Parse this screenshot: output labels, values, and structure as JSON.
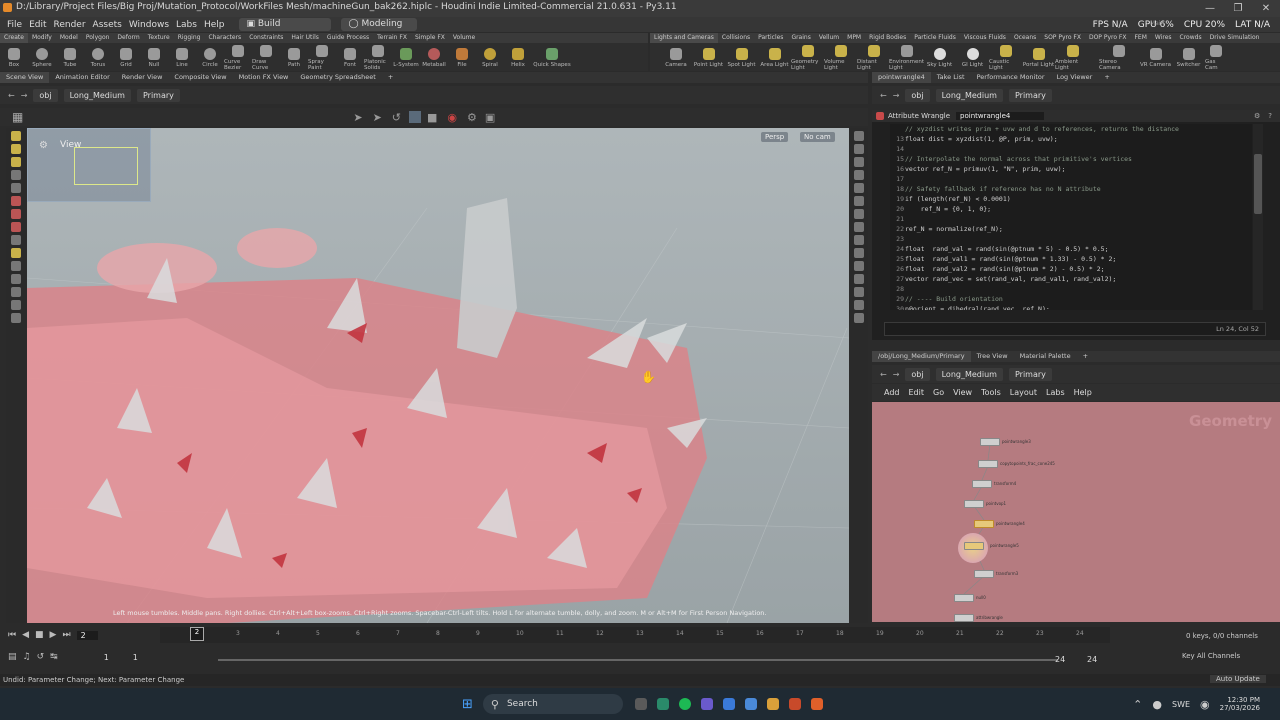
{
  "window": {
    "title": "D:/Library/Project Files/Big Proj/Mutation_Protocol/WorkFiles Mesh/machineGun_bak262.hiplc - Houdini Indie Limited-Commercial 21.0.631 - Py3.11"
  },
  "menubar": {
    "items": [
      "File",
      "Edit",
      "Render",
      "Assets",
      "Windows",
      "Labs",
      "Help"
    ],
    "desktops": [
      "Build",
      "Modeling"
    ],
    "stats": {
      "fps": "FPS N/A",
      "gpu": "GPU 6%",
      "cpu": "CPU 20%",
      "lat": "LAT N/A"
    },
    "main_label": "Main"
  },
  "shelf_left": {
    "tabs": [
      "Create",
      "Modify",
      "Model",
      "Polygon",
      "Deform",
      "Texture",
      "Rigging",
      "Characters",
      "Constraints",
      "Hair Utils",
      "Guide Process",
      "Terrain FX",
      "Simple FX",
      "Volume"
    ],
    "tools": [
      "Box",
      "Sphere",
      "Tube",
      "Torus",
      "Grid",
      "Null",
      "Line",
      "Circle",
      "Curve Bezier",
      "Draw Curve",
      "Path",
      "Spray Paint",
      "Font",
      "Platonic Solids",
      "L-System",
      "Metaball",
      "File",
      "Spiral",
      "Helix",
      "Quick Shapes"
    ]
  },
  "shelf_right": {
    "tabs": [
      "Lights and Cameras",
      "Collisions",
      "Particles",
      "Grains",
      "Vellum",
      "MPM",
      "Rigid Bodies",
      "Particle Fluids",
      "Viscous Fluids",
      "Oceans",
      "SOP Pyro FX",
      "DOP Pyro FX",
      "FEM",
      "Wires",
      "Crowds",
      "Drive Simulation"
    ],
    "tools": [
      "Camera",
      "Point Light",
      "Spot Light",
      "Area Light",
      "Geometry Light",
      "Volume Light",
      "Distant Light",
      "Environment Light",
      "Sky Light",
      "GI Light",
      "Caustic Light",
      "Portal Light",
      "Ambient Light",
      "Stereo Camera",
      "VR Camera",
      "Switcher",
      "Gas Cam"
    ]
  },
  "left_pane": {
    "tabs": [
      "Scene View",
      "Animation Editor",
      "Render View",
      "Composite View",
      "Motion FX View",
      "Geometry Spreadsheet"
    ],
    "path": [
      "obj",
      "Long_Medium",
      "Primary"
    ],
    "view_label": "View",
    "persp": "Persp",
    "cam": "No cam",
    "hint": "Left mouse tumbles. Middle pans. Right dollies. Ctrl+Alt+Left box-zooms. Ctrl+Right zooms. Spacebar-Ctrl-Left tilts. Hold L for alternate tumble, dolly, and zoom. M or Alt+M for First Person Navigation."
  },
  "right_top_pane": {
    "tabs": [
      "pointwrangle4",
      "Take List",
      "Performance Monitor",
      "Log Viewer"
    ],
    "path": [
      "obj",
      "Long_Medium",
      "Primary"
    ],
    "node_type": "Attribute Wrangle",
    "node_name": "pointwrangle4",
    "cursor_pos": "Ln 24, Col 52",
    "code_lines": [
      {
        "n": "",
        "t": "// xyzdist writes prim + uvw and d to references, returns the distance",
        "c": true
      },
      {
        "n": "13",
        "t": "float dist = xyzdist(1, @P, prim, uvw);",
        "c": false
      },
      {
        "n": "14",
        "t": "",
        "c": false
      },
      {
        "n": "15",
        "t": "// Interpolate the normal across that primitive's vertices",
        "c": true
      },
      {
        "n": "16",
        "t": "vector ref_N = primuv(1, \"N\", prim, uvw);",
        "c": false
      },
      {
        "n": "17",
        "t": "",
        "c": false
      },
      {
        "n": "18",
        "t": "// Safety fallback if reference has no N attribute",
        "c": true
      },
      {
        "n": "19",
        "t": "if (length(ref_N) < 0.0001)",
        "c": false
      },
      {
        "n": "20",
        "t": "    ref_N = {0, 1, 0};",
        "c": false
      },
      {
        "n": "21",
        "t": "",
        "c": false
      },
      {
        "n": "22",
        "t": "ref_N = normalize(ref_N);",
        "c": false
      },
      {
        "n": "23",
        "t": "",
        "c": false
      },
      {
        "n": "24",
        "t": "float  rand_val = rand(sin(@ptnum * 5) - 0.5) * 0.5;",
        "c": false
      },
      {
        "n": "25",
        "t": "float  rand_val1 = rand(sin(@ptnum * 1.33) - 0.5) * 2;",
        "c": false
      },
      {
        "n": "26",
        "t": "float  rand_val2 = rand(sin(@ptnum * 2) - 0.5) * 2;",
        "c": false
      },
      {
        "n": "27",
        "t": "vector rand_vec = set(rand_val, rand_val1, rand_val2);",
        "c": false
      },
      {
        "n": "28",
        "t": "",
        "c": false
      },
      {
        "n": "29",
        "t": "// ---- Build orientation",
        "c": true
      },
      {
        "n": "30",
        "t": "p@orient = dihedral(rand_vec, ref_N);",
        "c": false
      }
    ]
  },
  "right_bottom_pane": {
    "tabs": [
      "/obj/Long_Medium/Primary",
      "Tree View",
      "Material Palette"
    ],
    "path": [
      "obj",
      "Long_Medium",
      "Primary"
    ],
    "menu": [
      "Add",
      "Edit",
      "Go",
      "View",
      "Tools",
      "Layout",
      "Labs",
      "Help"
    ],
    "watermark": "Geometry",
    "nodes": [
      "pointwrangle3",
      "copytopoints_frac_cone245",
      "transform4",
      "pointvop1",
      "pointwrangle4",
      "pointwrangle5",
      "transform3",
      "null0",
      "attribwrangle"
    ]
  },
  "timeline": {
    "frame": "2",
    "ticks": [
      "2",
      "3",
      "4",
      "5",
      "6",
      "7",
      "8",
      "9",
      "10",
      "11",
      "12",
      "13",
      "14",
      "15",
      "16",
      "17",
      "18",
      "19",
      "20",
      "21",
      "22",
      "23",
      "24"
    ],
    "start": "1",
    "start2": "1",
    "end": "24",
    "end2": "24",
    "keys": "0 keys, 0/0 channels",
    "key_all": "Key All Channels",
    "auto_update": "Auto Update"
  },
  "status": {
    "text": "Undid: Parameter Change; Next: Parameter Change"
  },
  "taskbar": {
    "search": "Search",
    "lang": "SWE",
    "time": "12:30 PM",
    "date": "27/03/2026"
  }
}
